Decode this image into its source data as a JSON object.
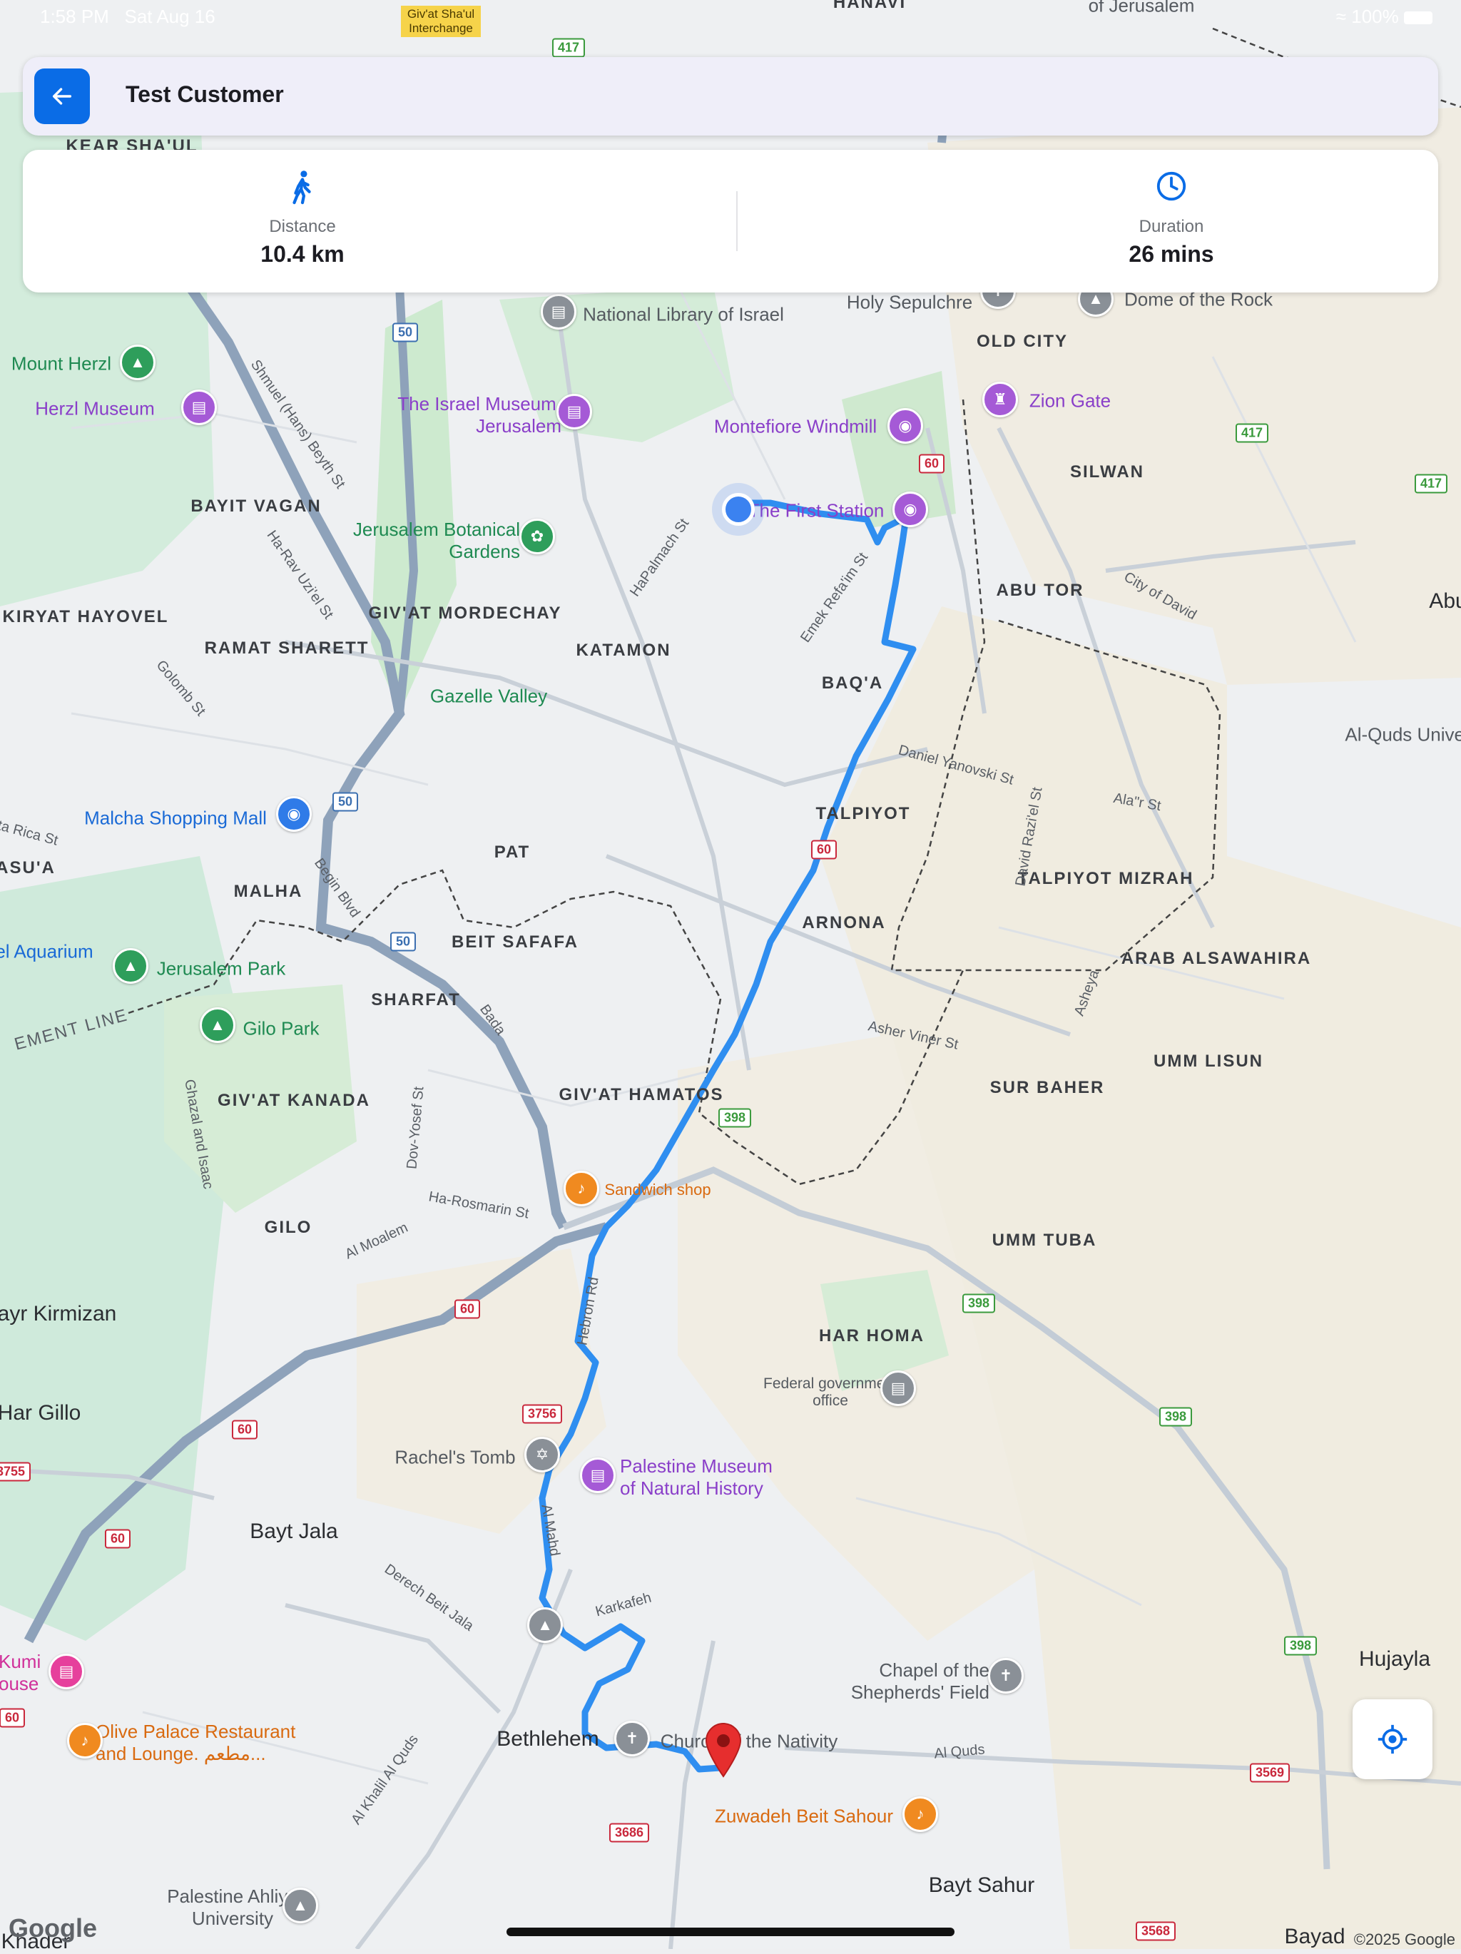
{
  "status_bar": {
    "time": "1:58 PM",
    "date": "Sat Aug 16",
    "battery": "100%"
  },
  "header": {
    "title": "Test Customer",
    "back_icon": "arrow-left-icon"
  },
  "route_info": {
    "distance_label": "Distance",
    "distance_value": "10.4 km",
    "distance_icon": "walking-person-icon",
    "duration_label": "Duration",
    "duration_value": "26 mins",
    "duration_icon": "clock-icon"
  },
  "map": {
    "areas": [
      "OLD CITY",
      "SILWAN",
      "ABU TOR",
      "BAQ'A",
      "TALPIYOT",
      "TALPIYOT MIZRAH",
      "ARNONA",
      "KATAMON",
      "GIV'AT MORDECHAY",
      "BAYIT VAGAN",
      "KIRYAT HAYOVEL",
      "RAMAT SHARETT",
      "PAT",
      "MALHA",
      "BEIT SAFAFA",
      "SHARFAT",
      "GIV'AT HAMATOS",
      "GIV'AT KANADA",
      "GILO",
      "SUR BAHER",
      "UMM LISUN",
      "UMM TUBA",
      "ARAB ALSAWAHIRA",
      "HAR HOMA",
      "KEAR SHA'UL",
      "HANAVI",
      "ASU'A"
    ],
    "towns": [
      "Bethlehem",
      "Bayt Jala",
      "Bayt Sahur",
      "Hujayla",
      "Abu",
      "ayr Kirmizan",
      "Har Gillo",
      "Bayad",
      "Khader"
    ],
    "pois": {
      "national_library": "National Library of Israel",
      "holy_sepulchre": "Holy Sepulchre",
      "dome_of_rock": "Dome of the Rock",
      "zion_gate": "Zion Gate",
      "montefiore": "Montefiore Windmill",
      "first_station": "The First Station",
      "israel_museum": "The Israel Museum, Jerusalem",
      "mount_herzl": "Mount Herzl",
      "herzl_museum": "Herzl Museum",
      "botanical_gardens": "Jerusalem Botanical Gardens",
      "gazelle_valley": "Gazelle Valley",
      "malcha_mall": "Malcha Shopping Mall",
      "aquarium": "el Aquarium",
      "jerusalem_park": "Jerusalem Park",
      "gilo_park": "Gilo Park",
      "sandwich_shop": "Sandwich shop",
      "rachels_tomb": "Rachel's Tomb",
      "palestine_museum": "Palestine Museum of Natural History",
      "federal_office": "Federal government office",
      "shepherds_field": "Chapel of the Shepherds' Field",
      "church_nativity": "Church of the Nativity",
      "olive_palace": "Olive Palace Restaurant and Lounge. مطعم...",
      "zuwadeh": "Zuwadeh Beit Sahour",
      "ahliya": "Palestine Ahliya University",
      "kumi": "Kumi ouse",
      "interchange": "Giv'at Sha'ul Interchange",
      "al_quds_univ": "Al-Quds Univers",
      "of_jerusalem": "of Jerusalem"
    },
    "streets": [
      "Shmuel (Hans) Beyth St",
      "Ha-Rav Uzi'el St",
      "HaPalmach St",
      "Emek Refa'im St",
      "Daniel Yanovski St",
      "Ala\"r St",
      "City of David",
      "David Razi'el St",
      "Asher Viner St",
      "Golomb St",
      "Begin Blvd",
      "Bada",
      "Dov-Yosef St",
      "Ha-Rosmarin St",
      "Al Moalem",
      "Hebron Rd",
      "Al Mahd",
      "Karkafeh",
      "Derech Beit Jala",
      "Al Khalil Al Quds",
      "Al Quds",
      "Ghazal and Isaac",
      "Asheya",
      "EMENT LINE",
      "sta Rica St"
    ],
    "shields": [
      "417",
      "50",
      "60",
      "398",
      "3756",
      "3755",
      "3686",
      "3569",
      "3568"
    ],
    "copyright": "©2025 Google",
    "logo": "Google"
  },
  "colors": {
    "accent": "#0a6ce6",
    "route": "#2f8ef0",
    "destination_pin": "#e62e2e"
  }
}
